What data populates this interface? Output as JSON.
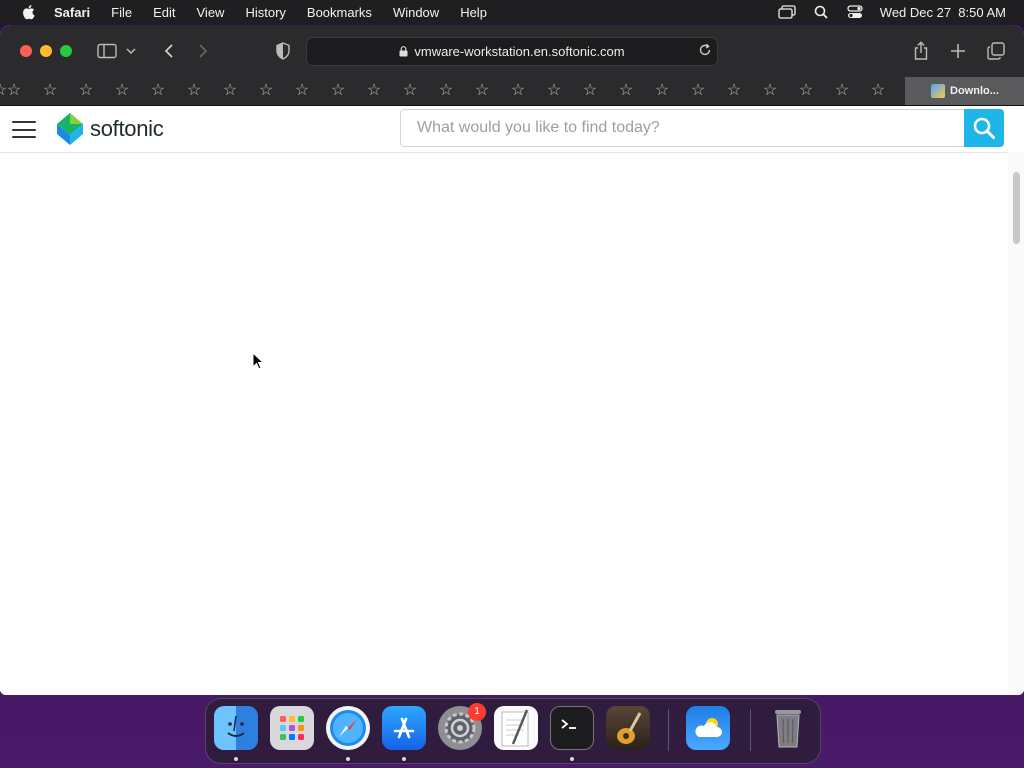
{
  "menubar": {
    "app_name": "Safari",
    "items": [
      "File",
      "Edit",
      "View",
      "History",
      "Bookmarks",
      "Window",
      "Help"
    ],
    "clock": "Wed Dec 27  8:50 AM"
  },
  "browser": {
    "url": "vmware-workstation.en.softonic.com",
    "download_tab_label": "Downlo..."
  },
  "site": {
    "logo_text": "softonic",
    "search_placeholder": "What would you like to find today?",
    "accent_color": "#1eb6e8"
  },
  "dock": {
    "apps": [
      "Finder",
      "Launchpad",
      "Safari",
      "App Store",
      "System Preferences",
      "TextEdit",
      "Terminal",
      "GarageBand",
      "Weather",
      "Trash"
    ],
    "system_preferences_badge": "1"
  }
}
